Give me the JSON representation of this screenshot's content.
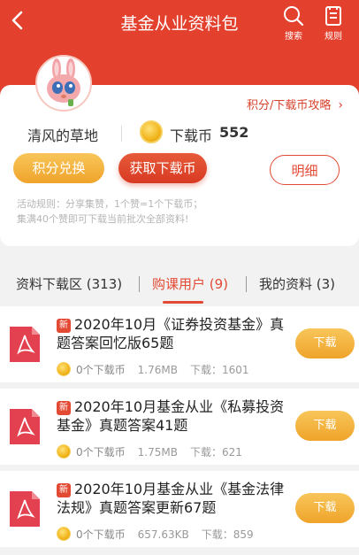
{
  "nav": {
    "title": "基金从业资料包",
    "search_label": "搜索",
    "rules_label": "规则"
  },
  "profile": {
    "strategy_link": "积分/下载币攻略",
    "username": "清风的草地",
    "coin_label": "下载币",
    "coin_count": "552",
    "exchange_button": "积分兑换",
    "get_coins_button": "获取下载币",
    "detail_button": "明细",
    "rules_line1": "活动规则：分享集赞，1个赞=1个下载币；",
    "rules_line2": "集满40个赞即可下载当前批次全部资料!"
  },
  "tabs": [
    {
      "label": "资料下载区 (313)"
    },
    {
      "label": "购课用户 (9)"
    },
    {
      "label": "我的资料 (3)"
    }
  ],
  "items": [
    {
      "badge": "新",
      "title": "2020年10月《证券投资基金》真题答案回忆版65题",
      "cost": "0个下载币",
      "size": "1.76MB",
      "downloads": "下载：1601",
      "button": "下载"
    },
    {
      "badge": "新",
      "title": "2020年10月基金从业《私募投资基金》真题答案41题",
      "cost": "0个下载币",
      "size": "1.75MB",
      "downloads": "下载：621",
      "button": "下载"
    },
    {
      "badge": "新",
      "title": "2020年10月基金从业《基金法律法规》真题答案更新67题",
      "cost": "0个下载币",
      "size": "657.63KB",
      "downloads": "下载：859",
      "button": "下载"
    }
  ],
  "colors": {
    "brand_red": "#e3412e",
    "accent_orange": "#efa42a",
    "active_tab": "#e24a34"
  }
}
